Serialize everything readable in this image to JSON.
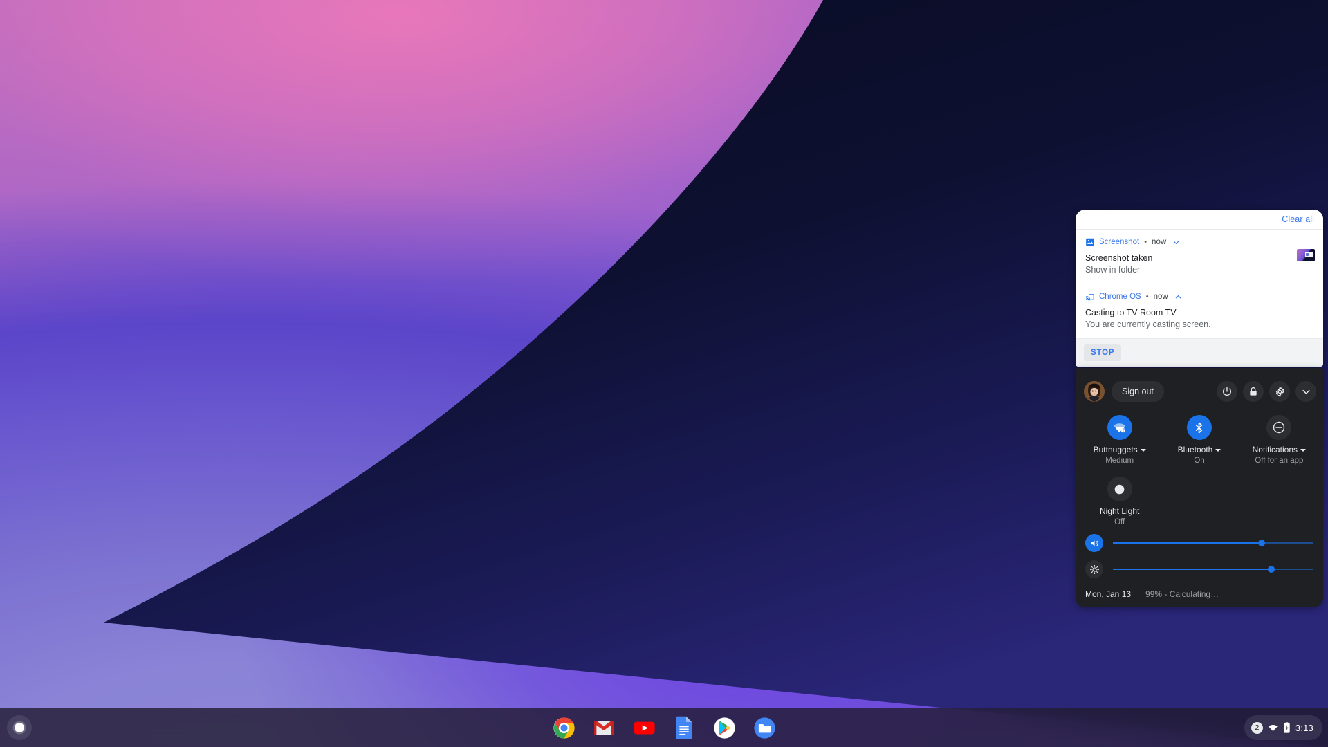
{
  "wallpaper": {
    "name": "chromeos-gradient-wallpaper",
    "colors": {
      "pink": "#e478ba",
      "magenta": "#b96ec0",
      "purple": "#7a57d4",
      "violet": "#6a4fd0",
      "periwinkle": "#8d86d8",
      "dark_navy": "#0c0e24"
    }
  },
  "message_center": {
    "clear_all_label": "Clear all",
    "notifications": [
      {
        "app_icon": "image-icon",
        "app_name": "Screenshot",
        "separator": "•",
        "time": "now",
        "chevron": "chevron-down-icon",
        "title": "Screenshot taken",
        "body": "Show in folder",
        "has_thumbnail": true
      },
      {
        "app_icon": "cast-icon",
        "app_name": "Chrome OS",
        "separator": "•",
        "time": "now",
        "chevron": "chevron-up-icon",
        "title": "Casting to TV Room TV",
        "body": "You are currently casting screen.",
        "has_thumbnail": false
      }
    ],
    "action_button_label": "STOP"
  },
  "quick_settings": {
    "avatar": "user-avatar",
    "sign_out_label": "Sign out",
    "buttons": [
      {
        "name": "power-button",
        "icon": "power-icon"
      },
      {
        "name": "lock-button",
        "icon": "lock-icon"
      },
      {
        "name": "settings-button",
        "icon": "gear-icon"
      },
      {
        "name": "collapse-button",
        "icon": "chevron-down-icon"
      }
    ],
    "tiles": [
      {
        "icon": "wifi-locked-icon",
        "label": "Buttnuggets",
        "state": "Medium",
        "active": true,
        "has_caret": true
      },
      {
        "icon": "bluetooth-icon",
        "label": "Bluetooth",
        "state": "On",
        "active": true,
        "has_caret": true
      },
      {
        "icon": "do-not-disturb-icon",
        "label": "Notifications",
        "state": "Off for an app",
        "active": false,
        "has_caret": true
      },
      {
        "icon": "night-light-icon",
        "label": "Night Light",
        "state": "Off",
        "active": false,
        "has_caret": false
      }
    ],
    "sliders": [
      {
        "name": "volume-slider",
        "icon": "volume-icon",
        "value": 74,
        "active": true
      },
      {
        "name": "brightness-slider",
        "icon": "brightness-icon",
        "value": 79,
        "active": false
      }
    ],
    "footer": {
      "date": "Mon, Jan 13",
      "battery": "99% - Calculating…"
    },
    "accent_color": "#1a73e8",
    "panel_color": "#1f2023"
  },
  "shelf": {
    "launcher": "launcher-button",
    "apps": [
      {
        "name": "chrome",
        "label": "Chrome"
      },
      {
        "name": "gmail",
        "label": "Gmail"
      },
      {
        "name": "youtube",
        "label": "YouTube"
      },
      {
        "name": "docs",
        "label": "Google Docs"
      },
      {
        "name": "play-store",
        "label": "Play Store"
      },
      {
        "name": "files",
        "label": "Files"
      }
    ],
    "status_tray": {
      "badge_count": "2",
      "wifi_icon": "wifi-icon",
      "battery_icon": "battery-charging-icon",
      "time": "3:13"
    }
  }
}
